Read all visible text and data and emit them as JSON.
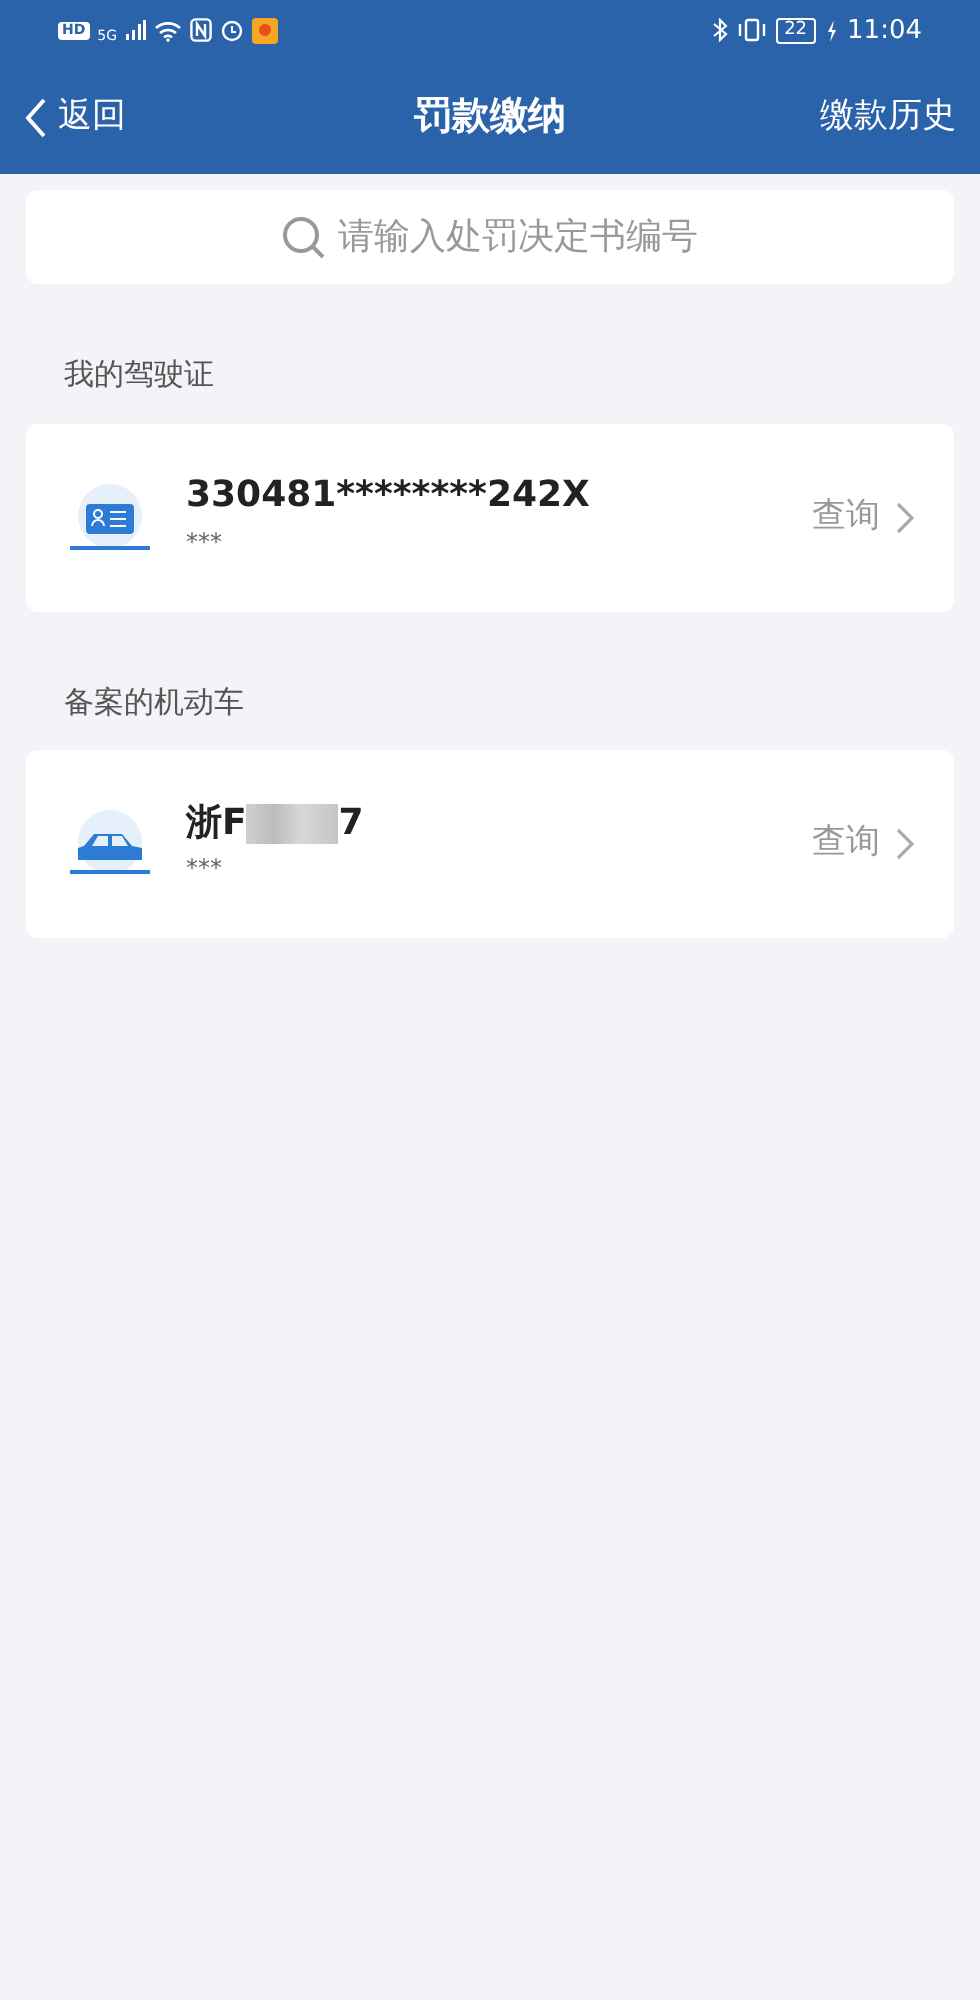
{
  "status_bar": {
    "hd": "HD",
    "network": "5G",
    "battery": "22",
    "time": "11:04"
  },
  "header": {
    "back": "返回",
    "title": "罚款缴纳",
    "action": "缴款历史"
  },
  "search": {
    "placeholder": "请输入处罚决定书编号"
  },
  "sections": [
    {
      "title": "我的驾驶证",
      "items": [
        {
          "kind": "license",
          "title": "330481********242X",
          "subtitle": "***",
          "action": "查询"
        }
      ]
    },
    {
      "title": "备案的机动车",
      "items": [
        {
          "kind": "vehicle",
          "title": "浙F",
          "redacted": true,
          "title_end": "7",
          "subtitle": "***",
          "action": "查询"
        }
      ]
    }
  ]
}
